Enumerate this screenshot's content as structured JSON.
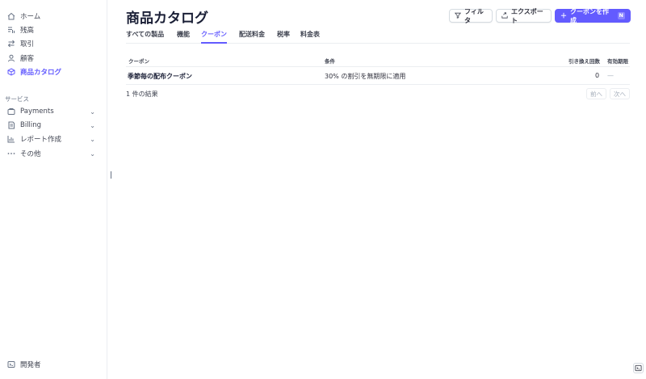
{
  "sidebar": {
    "items": [
      {
        "label": "ホーム",
        "icon": "home-icon"
      },
      {
        "label": "残高",
        "icon": "balance-icon"
      },
      {
        "label": "取引",
        "icon": "transactions-icon"
      },
      {
        "label": "顧客",
        "icon": "customer-icon"
      },
      {
        "label": "商品カタログ",
        "icon": "product-catalog-icon"
      }
    ],
    "section_label": "サービス",
    "services": [
      {
        "label": "Payments",
        "icon": "payments-icon"
      },
      {
        "label": "Billing",
        "icon": "billing-icon"
      },
      {
        "label": "レポート作成",
        "icon": "reports-icon"
      },
      {
        "label": "その他",
        "icon": "more-icon"
      }
    ],
    "developer": {
      "label": "開発者",
      "icon": "terminal-icon"
    }
  },
  "header": {
    "title": "商品カタログ",
    "filter_label": "フィルタ",
    "export_label": "エクスポート",
    "create_label": "クーポンを作成",
    "create_shortcut": "N"
  },
  "tabs": [
    "すべての製品",
    "機能",
    "クーポン",
    "配送料金",
    "税率",
    "料金表"
  ],
  "active_tab": "クーポン",
  "table": {
    "columns": [
      "クーポン",
      "条件",
      "引き換え回数",
      "有効期限"
    ],
    "rows": [
      {
        "coupon": "季節毎の配布クーポン",
        "terms": "30% の割引を無期限に適用",
        "redemptions": "0",
        "expires": "—"
      }
    ]
  },
  "footer": {
    "results": "1 件の結果",
    "prev": "前へ",
    "next": "次へ"
  },
  "colors": {
    "accent": "#635bff",
    "text": "#1a1f36",
    "border": "#ebeef1"
  }
}
